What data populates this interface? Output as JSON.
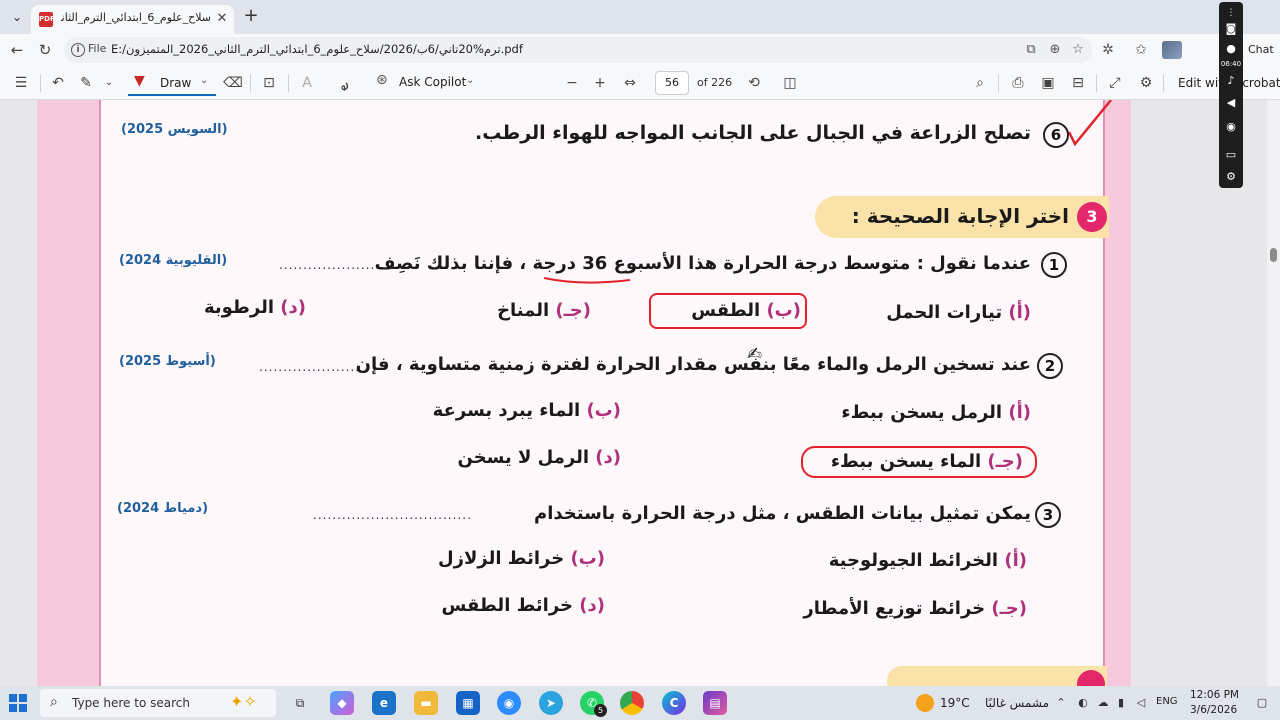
{
  "browser": {
    "tab_title": "سلاح_علوم_6_ابتدائي_الترم_الثاني_6...*",
    "pdf_icon_text": "PDF",
    "file_label": "File",
    "url": "E:/ترم%20تاني/6ب/2026/سلاح_علوم_6_ابتدائي_الترم_الثاني_2026_المتميزون.pdf"
  },
  "pdf_toolbar": {
    "draw_label": "Draw",
    "copilot_label": "Ask Copilot",
    "page_current": "56",
    "page_total": "of 226",
    "edit_label": "Edit with Acrobat"
  },
  "recorder": {
    "time": "06:40",
    "chat_label": "Chat"
  },
  "document": {
    "prev_item": {
      "number": "6",
      "text": "تصلح الزراعة في الجبال على الجانب المواجه للهواء الرطب.",
      "source": "(السويس 2025)"
    },
    "section_number": "3",
    "section_title": "اختر الإجابة الصحيحة :",
    "questions": [
      {
        "number": "1",
        "text": "عندما نقول : متوسط درجة الحرارة هذا الأسبوع 36 درجة ، فإننا بذلك نَصِف",
        "dots": ".....................",
        "source": "(القليوبية 2024)",
        "options": [
          {
            "letter": "(أ)",
            "text": "تيارات الحمل"
          },
          {
            "letter": "(ب)",
            "text": "الطقس"
          },
          {
            "letter": "(جـ)",
            "text": "المناخ"
          },
          {
            "letter": "(د)",
            "text": "الرطوبة"
          }
        ]
      },
      {
        "number": "2",
        "text": "عند تسخين الرمل والماء معًا بنفس مقدار الحرارة لفترة زمنية متساوية ، فإن",
        "dots": ".....................",
        "source": "(أسيوط 2025)",
        "options": [
          {
            "letter": "(أ)",
            "text": "الرمل يسخن ببطء"
          },
          {
            "letter": "(ب)",
            "text": "الماء يبرد بسرعة"
          },
          {
            "letter": "(جـ)",
            "text": "الماء يسخن ببطء"
          },
          {
            "letter": "(د)",
            "text": "الرمل لا يسخن"
          }
        ]
      },
      {
        "number": "3",
        "text": "يمكن تمثيل بيانات الطقس ، مثل درجة الحرارة باستخدام",
        "dots": ".................................",
        "source": "(دمياط 2024)",
        "options": [
          {
            "letter": "(أ)",
            "text": "الخرائط الجيولوجية"
          },
          {
            "letter": "(ب)",
            "text": "خرائط الزلازل"
          },
          {
            "letter": "(جـ)",
            "text": "خرائط توزيع الأمطار"
          },
          {
            "letter": "(د)",
            "text": "خرائط الطقس"
          }
        ]
      }
    ]
  },
  "taskbar": {
    "search_placeholder": "Type here to search",
    "whatsapp_badge": "5",
    "weather_temp": "19°C",
    "weather_desc": "مشمس غالبًا",
    "lang": "ENG",
    "time": "12:06 PM",
    "date": "3/6/2026"
  }
}
